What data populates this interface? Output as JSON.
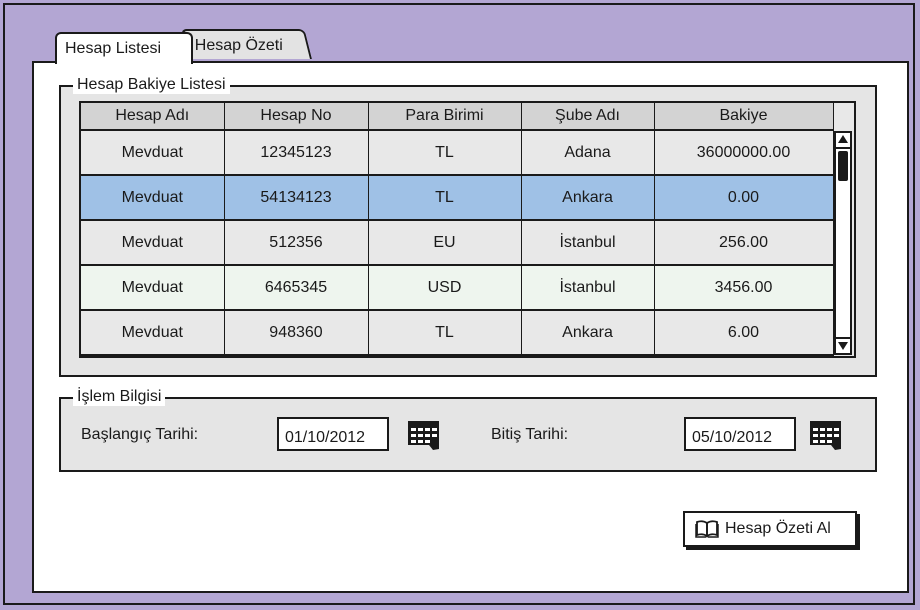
{
  "tabs": [
    {
      "label": "Hesap Listesi",
      "active": true
    },
    {
      "label": "Hesap Özeti",
      "active": false
    }
  ],
  "account_group": {
    "title": "Hesap Bakiye Listesi",
    "columns": [
      "Hesap Adı",
      "Hesap No",
      "Para Birimi",
      "Şube Adı",
      "Bakiye"
    ],
    "rows": [
      {
        "name": "Mevduat",
        "no": "12345123",
        "currency": "TL",
        "branch": "Adana",
        "balance": "36000000.00",
        "selected": false
      },
      {
        "name": "Mevduat",
        "no": "54134123",
        "currency": "TL",
        "branch": "Ankara",
        "balance": "0.00",
        "selected": true
      },
      {
        "name": "Mevduat",
        "no": "512356",
        "currency": "EU",
        "branch": "İstanbul",
        "balance": "256.00",
        "selected": false
      },
      {
        "name": "Mevduat",
        "no": "6465345",
        "currency": "USD",
        "branch": "İstanbul",
        "balance": "3456.00",
        "selected": false
      },
      {
        "name": "Mevduat",
        "no": "948360",
        "currency": "TL",
        "branch": "Ankara",
        "balance": "6.00",
        "selected": false
      }
    ]
  },
  "transaction_group": {
    "title": "İşlem Bilgisi",
    "start_label": "Başlangıç Tarihi:",
    "start_value": "01/10/2012",
    "end_label": "Bitiş Tarihi:",
    "end_value": "05/10/2012"
  },
  "action": {
    "label": "Hesap Özeti Al",
    "icon": "open-book-icon"
  },
  "colors": {
    "background": "#b3a6d3",
    "selected_row": "#9fc1e6",
    "alt_row": "#eef5ee",
    "row": "#e8e8e8",
    "header": "#d3d3d3"
  }
}
